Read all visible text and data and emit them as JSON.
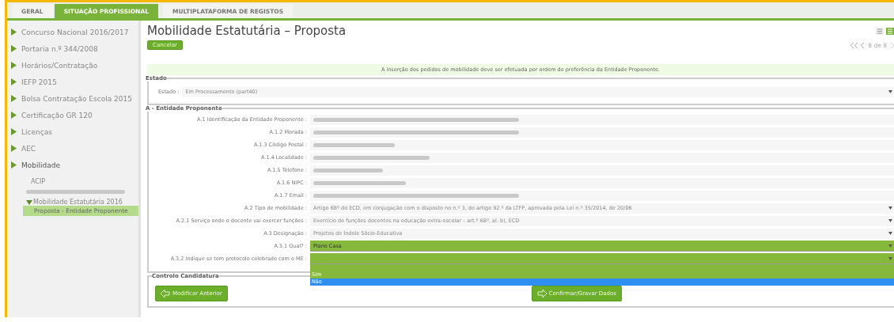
{
  "tabs": [
    {
      "label": "GERAL",
      "selected": false
    },
    {
      "label": "SITUAÇÃO PROFISSIONAL",
      "selected": true
    },
    {
      "label": "MULTIPLATAFORMA DE REGISTOS",
      "selected": false
    }
  ],
  "sidebar": {
    "items": [
      {
        "label": "Concurso Nacional 2016/2017",
        "expanded": false
      },
      {
        "label": "Portaria n.º 344/2008",
        "expanded": false
      },
      {
        "label": "Horários/Contratação",
        "expanded": false
      },
      {
        "label": "IEFP 2015",
        "expanded": false
      },
      {
        "label": "Bolsa Contratação Escola 2015",
        "expanded": false
      },
      {
        "label": "Certificação GR 120",
        "expanded": false
      },
      {
        "label": "Licenças",
        "expanded": false
      },
      {
        "label": "AEC",
        "expanded": false
      },
      {
        "label": "Mobilidade",
        "expanded": true,
        "children": [
          {
            "kind": "link",
            "label": "ACIP"
          },
          {
            "kind": "redacted"
          },
          {
            "kind": "folder",
            "label": "Mobilidade Estatutária 2016",
            "expanded": true,
            "children": [
              {
                "label": "Proposta - Entidade Proponente",
                "selected": true
              }
            ]
          }
        ]
      }
    ]
  },
  "page": {
    "title": "Mobilidade Estatutária – Proposta",
    "cancel_button": "Cancelar",
    "pager": "8 de 8",
    "notice": "A inserção dos pedidos de mobilidade deve ser efetuada por ordem de preferência da Entidade Proponente."
  },
  "estado": {
    "legend": "Estado",
    "label": "Estado :",
    "value": "Em Processamento (part40)"
  },
  "entidade": {
    "legend": "A - Entidade Proponente",
    "rows": [
      {
        "label": "A.1 Identificação da Entidade Proponente :",
        "kind": "redacted"
      },
      {
        "label": "A.1.2 Morada :",
        "kind": "redacted"
      },
      {
        "label": "A.1.3 Código Postal :",
        "kind": "redacted"
      },
      {
        "label": "A.1.4 Localidade :",
        "kind": "redacted"
      },
      {
        "label": "A.1.5 Telefone :",
        "kind": "redacted"
      },
      {
        "label": "A.1.6 NIPC :",
        "kind": "redacted"
      },
      {
        "label": "A.1.7 Email :",
        "kind": "redacted"
      },
      {
        "label": "A.2 Tipo de mobilidade :",
        "kind": "select",
        "highlighted": false,
        "value": "Artigo 68º do ECD, em conjugação com o disposto no n.º 3, do artigo 92.º da LTFP, aprovada pela Lei n.º 35/2014, de 20/06"
      },
      {
        "label": "A.2.1 Serviço onde o docente vai exercer funções :",
        "kind": "select",
        "highlighted": false,
        "value": "Exercício de funções docentes na educação extra-escolar – art.º 68º, al. b), ECD"
      },
      {
        "label": "A.3 Designação :",
        "kind": "select",
        "highlighted": false,
        "value": "Projetos de Índole Sócio-Educativa"
      },
      {
        "label": "A.3.1 Qual? :",
        "kind": "select",
        "highlighted": true,
        "value": "Plano Casa"
      },
      {
        "label": "A.3.2 Indique se tem protocolo celebrado com o ME  :",
        "kind": "select",
        "highlighted": true,
        "expanded": true,
        "options": [
          {
            "label": "Sim",
            "selected": false
          },
          {
            "label": "Não",
            "selected": true
          }
        ]
      }
    ]
  },
  "controlo": {
    "legend": "Controlo Candidatura",
    "buttons": [
      "Modificar Anterior",
      "Confirmar/Gravar Dados"
    ]
  }
}
